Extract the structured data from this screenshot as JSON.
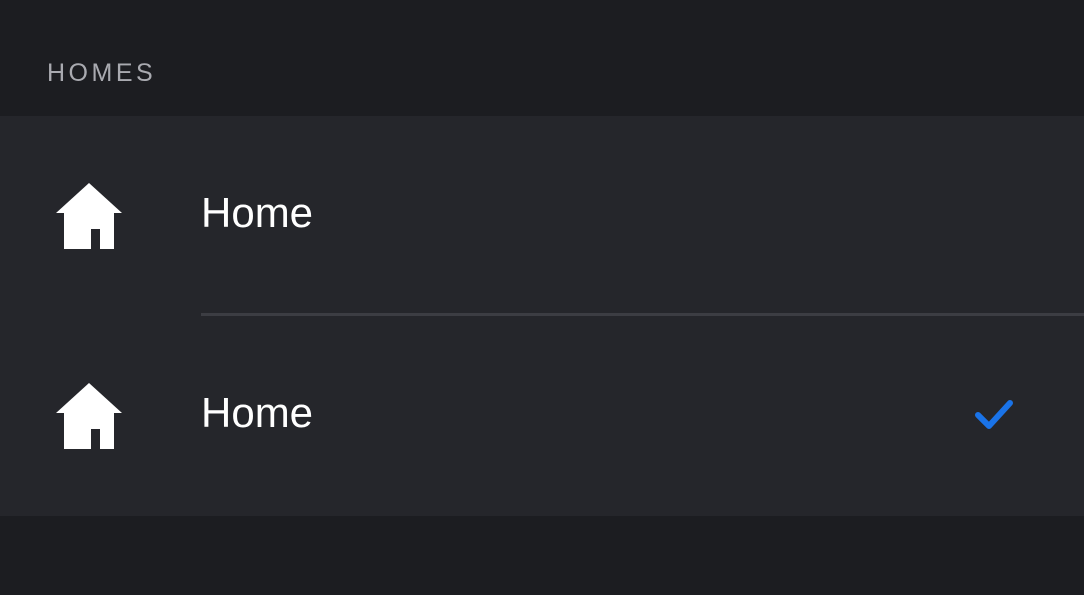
{
  "section": {
    "title": "HOMES"
  },
  "homes": [
    {
      "name": "Home",
      "icon": "house-icon",
      "selected": false
    },
    {
      "name": "Home",
      "icon": "house-icon",
      "selected": true
    }
  ],
  "colors": {
    "background": "#1c1d21",
    "list_background": "#25262b",
    "header_text": "#a9aab0",
    "item_text": "#ffffff",
    "separator": "#3c3d43",
    "checkmark_accent": "#1a73e8"
  }
}
